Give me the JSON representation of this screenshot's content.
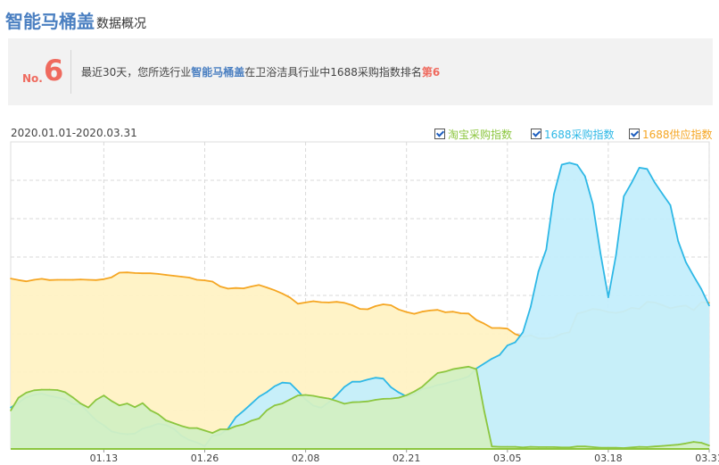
{
  "header": {
    "title": "智能马桶盖",
    "subtitle": "数据概况"
  },
  "summary": {
    "rank_prefix": "No.",
    "rank_value": "6",
    "text_before": "最近30天，您所选行业",
    "industry": "智能马桶盖",
    "text_middle": "在卫浴洁具行业中1688采购指数排名",
    "rank_text": "第6"
  },
  "date_range": "2020.01.01-2020.03.31",
  "legend": [
    {
      "label": "淘宝采购指数",
      "color": "#8cc63f",
      "checked": true
    },
    {
      "label": "1688采购指数",
      "color": "#2eb8e6",
      "checked": true
    },
    {
      "label": "1688供应指数",
      "color": "#f5a623",
      "checked": true
    }
  ],
  "chart_data": {
    "type": "area",
    "x_start": "2020-01-01",
    "x_end": "2020-03-31",
    "x_tick_labels": [
      "01.13",
      "01.26",
      "02.08",
      "02.21",
      "03.05",
      "03.18",
      "03.31"
    ],
    "x_tick_dates": [
      "2020-01-13",
      "2020-01-26",
      "2020-02-08",
      "2020-02-21",
      "2020-03-05",
      "2020-03-18",
      "2020-03-31"
    ],
    "ylim": [
      0,
      100
    ],
    "grid": true,
    "legend_position": "top-right",
    "series": [
      {
        "name": "1688供应指数",
        "color": "#f5a623",
        "fill": "#fff2c4",
        "values": [
          55.5,
          55.0,
          54.6,
          55.1,
          55.4,
          55.0,
          55.1,
          55.1,
          55.1,
          55.2,
          55.1,
          55.0,
          55.3,
          55.9,
          57.4,
          57.5,
          57.3,
          57.2,
          57.2,
          57.0,
          56.7,
          56.4,
          56.1,
          55.8,
          55.1,
          54.9,
          54.5,
          52.9,
          52.2,
          52.4,
          52.3,
          52.9,
          53.4,
          52.6,
          51.7,
          50.6,
          49.3,
          47.3,
          47.7,
          48.1,
          47.8,
          47.7,
          47.9,
          47.6,
          46.8,
          45.6,
          45.5,
          46.5,
          47.1,
          46.8,
          45.4,
          44.6,
          44.0,
          44.7,
          45.1,
          45.3,
          44.5,
          44.7,
          44.2,
          44.1,
          42.0,
          40.8,
          39.4,
          39.4,
          39.2,
          37.4,
          36.5,
          37.0,
          36.0,
          36.0,
          36.3,
          37.5,
          38.0,
          44.1,
          44.7,
          45.6,
          45.3,
          44.6,
          44.3,
          44.8,
          46.0,
          45.6,
          47.9,
          47.7,
          46.8,
          45.8,
          46.4,
          46.7,
          45.2,
          47.8,
          47.6
        ]
      },
      {
        "name": "1688采购指数",
        "color": "#2eb8e6",
        "fill": "#c4eefc",
        "values": [
          13.5,
          15.1,
          16.8,
          17.6,
          18.0,
          17.3,
          16.8,
          16.2,
          14.6,
          14.6,
          11.9,
          9.3,
          7.7,
          5.7,
          5.1,
          4.8,
          5.0,
          6.6,
          7.3,
          8.2,
          7.8,
          6.6,
          4.3,
          2.9,
          2.1,
          0.9,
          4.3,
          4.7,
          6.6,
          10.3,
          12.4,
          14.7,
          17.0,
          18.5,
          20.4,
          21.6,
          21.4,
          18.9,
          16.1,
          14.1,
          13.4,
          15.2,
          17.5,
          20.2,
          21.9,
          21.9,
          22.6,
          23.2,
          22.9,
          20.1,
          18.4,
          17.1,
          17.8,
          19.5,
          20.0,
          20.8,
          21.3,
          22.1,
          22.7,
          23.6,
          26.2,
          27.8,
          29.4,
          30.6,
          33.7,
          34.7,
          38.0,
          46.3,
          57.8,
          64.9,
          83.0,
          92.6,
          93.2,
          92.5,
          88.8,
          79.8,
          63.6,
          49.4,
          63.2,
          82.3,
          86.7,
          91.6,
          91.2,
          86.7,
          83.0,
          79.4,
          67.7,
          60.8,
          56.3,
          52.0,
          46.7
        ]
      },
      {
        "name": "淘宝采购指数",
        "color": "#8cc63f",
        "fill": "#d3efc3",
        "values": [
          12.5,
          16.7,
          18.3,
          19.1,
          19.3,
          19.3,
          19.2,
          18.5,
          16.8,
          14.8,
          13.5,
          16.0,
          17.4,
          15.6,
          14.2,
          14.8,
          13.6,
          14.9,
          12.6,
          11.3,
          9.3,
          8.4,
          7.5,
          6.8,
          6.8,
          6.0,
          5.2,
          6.4,
          6.4,
          7.4,
          8.0,
          9.2,
          9.9,
          12.6,
          14.2,
          14.8,
          16.1,
          17.4,
          17.6,
          17.3,
          16.8,
          16.4,
          15.6,
          14.7,
          15.2,
          15.3,
          15.5,
          16.0,
          16.3,
          16.4,
          16.7,
          17.5,
          18.7,
          20.2,
          22.5,
          24.7,
          25.2,
          26.0,
          26.4,
          26.8,
          26.0,
          12.5,
          0.8,
          0.7,
          0.7,
          0.7,
          0.5,
          0.7,
          0.6,
          0.6,
          0.6,
          0.5,
          0.5,
          0.8,
          0.8,
          0.6,
          0.4,
          0.4,
          0.4,
          0.3,
          0.5,
          0.7,
          0.6,
          0.8,
          1.0,
          1.2,
          1.4,
          1.8,
          2.3,
          2.0,
          1.1
        ]
      }
    ]
  }
}
